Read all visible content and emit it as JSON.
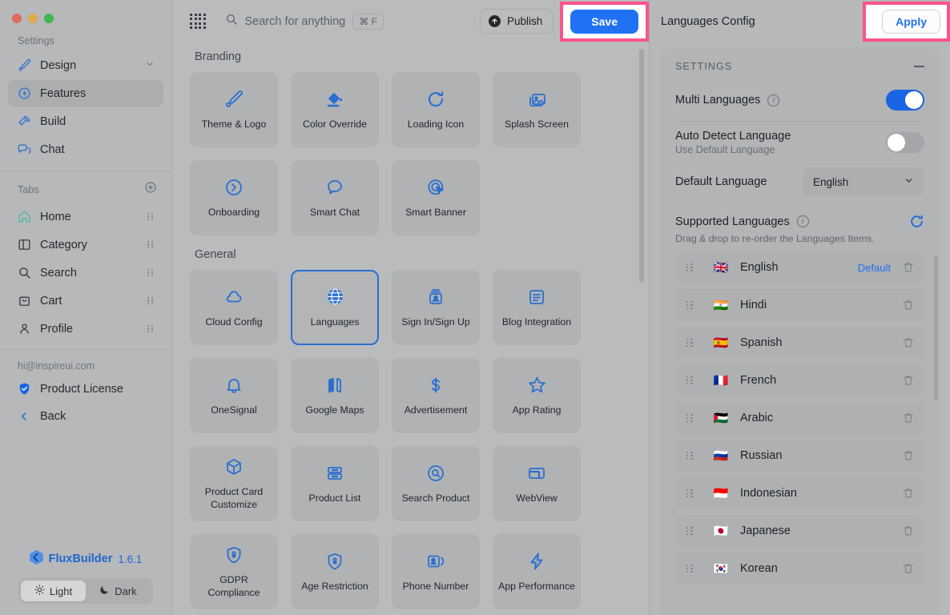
{
  "sidebar": {
    "window_controls": [
      "close",
      "minimize",
      "maximize"
    ],
    "settings_label": "Settings",
    "settings_items": [
      {
        "label": "Design",
        "icon": "brush-icon",
        "trailing": "chevron-down-icon"
      },
      {
        "label": "Features",
        "icon": "feature-icon",
        "active": true
      },
      {
        "label": "Build",
        "icon": "hammer-icon"
      },
      {
        "label": "Chat",
        "icon": "chat-icon"
      }
    ],
    "tabs_label": "Tabs",
    "tabs_add": "add-tab-icon",
    "tabs_items": [
      {
        "label": "Home",
        "icon": "home-icon"
      },
      {
        "label": "Category",
        "icon": "category-icon"
      },
      {
        "label": "Search",
        "icon": "search-icon"
      },
      {
        "label": "Cart",
        "icon": "cart-icon"
      },
      {
        "label": "Profile",
        "icon": "profile-icon"
      }
    ],
    "account_email": "hi@inspireui.com",
    "product_license": "Product License",
    "back": "Back",
    "brand_name": "FluxBuilder",
    "brand_version": "1.6.1",
    "theme": {
      "light": "Light",
      "dark": "Dark",
      "selected": "Light"
    }
  },
  "topbar": {
    "apps_icon": "apps-grid-icon",
    "search_placeholder": "Search for anything",
    "search_shortcut": "⌘ F",
    "publish_label": "Publish",
    "save_label": "Save",
    "highlight_color": "#f9548c",
    "save_color": "#2172f3"
  },
  "main": {
    "groups": [
      {
        "title": "Branding",
        "cards": [
          {
            "label": "Theme & Logo",
            "icon": "brush-icon"
          },
          {
            "label": "Color Override",
            "icon": "paint-bucket-icon"
          },
          {
            "label": "Loading Icon",
            "icon": "refresh-icon"
          },
          {
            "label": "Splash Screen",
            "icon": "images-icon"
          },
          {
            "label": "Onboarding",
            "icon": "arrow-circle-icon"
          },
          {
            "label": "Smart Chat",
            "icon": "speech-bubble-icon"
          },
          {
            "label": "Smart Banner",
            "icon": "target-cursor-icon"
          }
        ]
      },
      {
        "title": "General",
        "cards": [
          {
            "label": "Cloud Config",
            "icon": "cloud-icon"
          },
          {
            "label": "Languages",
            "icon": "globe-icon",
            "selected": true
          },
          {
            "label": "Sign In/Sign Up",
            "icon": "id-card-icon"
          },
          {
            "label": "Blog Integration",
            "icon": "document-icon"
          },
          {
            "label": "OneSignal",
            "icon": "bell-icon"
          },
          {
            "label": "Google Maps",
            "icon": "map-icon"
          },
          {
            "label": "Advertisement",
            "icon": "dollar-icon"
          },
          {
            "label": "App Rating",
            "icon": "star-icon"
          },
          {
            "label": "Product Card Customize",
            "icon": "cube-icon"
          },
          {
            "label": "Product List",
            "icon": "list-icon"
          },
          {
            "label": "Search Product",
            "icon": "search-circle-icon"
          },
          {
            "label": "WebView",
            "icon": "webview-icon"
          },
          {
            "label": "GDPR Compliance",
            "icon": "shield-lock-icon"
          },
          {
            "label": "Age Restriction",
            "icon": "shield-lock-icon"
          },
          {
            "label": "Phone Number",
            "icon": "contact-phone-icon"
          },
          {
            "label": "App Performance",
            "icon": "bolt-icon"
          }
        ]
      }
    ]
  },
  "right": {
    "title": "Languages Config",
    "apply_label": "Apply",
    "settings_header": "SETTINGS",
    "multi_languages": {
      "label": "Multi Languages",
      "enabled": true,
      "info": "info-icon"
    },
    "auto_detect": {
      "label": "Auto Detect Language",
      "sub": "Use Default Language",
      "enabled": false
    },
    "default_language": {
      "label": "Default Language",
      "value": "English"
    },
    "supported": {
      "label": "Supported Languages",
      "hint": "Drag & drop to re-order the Languages Items.",
      "refresh_icon": "refresh-icon",
      "info": "info-icon",
      "default_tag": "Default",
      "items": [
        {
          "name": "English",
          "flag": "🇬🇧",
          "is_default": true
        },
        {
          "name": "Hindi",
          "flag": "🇮🇳"
        },
        {
          "name": "Spanish",
          "flag": "🇪🇸"
        },
        {
          "name": "French",
          "flag": "🇫🇷"
        },
        {
          "name": "Arabic",
          "flag": "🇵🇸"
        },
        {
          "name": "Russian",
          "flag": "🇷🇺"
        },
        {
          "name": "Indonesian",
          "flag": "🇮🇩"
        },
        {
          "name": "Japanese",
          "flag": "🇯🇵"
        },
        {
          "name": "Korean",
          "flag": "🇰🇷"
        }
      ]
    }
  }
}
